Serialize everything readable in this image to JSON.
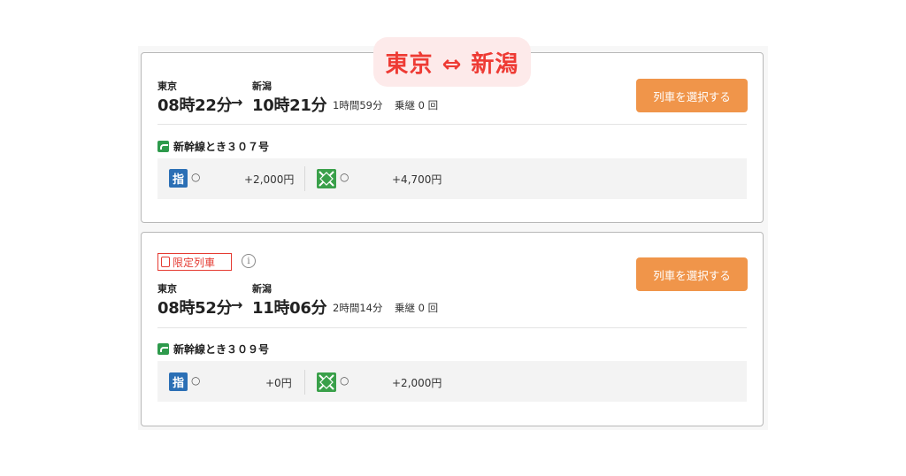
{
  "route": {
    "label": "東京 ⇔ 新潟"
  },
  "trains": [
    {
      "limited_label": "",
      "from_station": "東京",
      "to_station": "新潟",
      "depart": "08時22分",
      "arrow": "→",
      "arrive": "10時21分",
      "duration": "1時間59分",
      "transfers": "乗継 0 回",
      "select_label": "列車を選択する",
      "train_name": "新幹線とき３０７号",
      "reserved_icon": "指",
      "reserved_status": "○",
      "reserved_price": "+2,000円",
      "green_status": "○",
      "green_price": "+4,700円"
    },
    {
      "limited_label": "限定列車",
      "info": "i",
      "from_station": "東京",
      "to_station": "新潟",
      "depart": "08時52分",
      "arrow": "→",
      "arrive": "11時06分",
      "duration": "2時間14分",
      "transfers": "乗継 0 回",
      "select_label": "列車を選択する",
      "train_name": "新幹線とき３０９号",
      "reserved_icon": "指",
      "reserved_status": "○",
      "reserved_price": "+0円",
      "green_status": "○",
      "green_price": "+2,000円"
    }
  ],
  "colors": {
    "accent": "#ee3b34",
    "button": "#f0954a",
    "reserved_icon": "#2b6fb5",
    "green_icon": "#3aa04a"
  }
}
